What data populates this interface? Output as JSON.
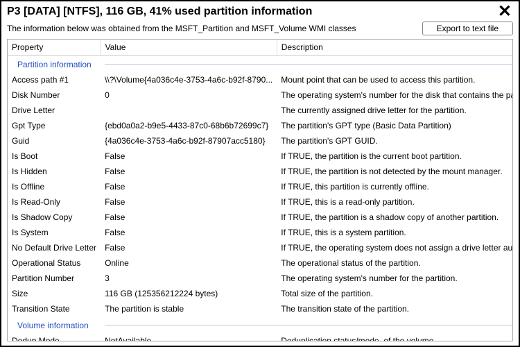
{
  "header": {
    "title": "P3 [DATA] [NTFS], 116 GB, 41% used partition information"
  },
  "subhead": {
    "text": "The information below was obtained from the MSFT_Partition and MSFT_Volume WMI classes",
    "export_label": "Export to text file"
  },
  "columns": {
    "prop": "Property",
    "val": "Value",
    "desc": "Description"
  },
  "sections": [
    {
      "name": "Partition information",
      "rows": [
        {
          "prop": "Access path #1",
          "val": "\\\\?\\Volume{4a036c4e-3753-4a6c-b92f-8790...",
          "desc": "Mount point that can be used to access this partition."
        },
        {
          "prop": "Disk Number",
          "val": "0",
          "desc": "The operating system's number for the disk that contains the partition."
        },
        {
          "prop": "Drive Letter",
          "val": "",
          "desc": "The currently assigned drive letter for the partition."
        },
        {
          "prop": "Gpt Type",
          "val": "{ebd0a0a2-b9e5-4433-87c0-68b6b72699c7}",
          "desc": "The partition's GPT type (Basic Data Partition)"
        },
        {
          "prop": "Guid",
          "val": "{4a036c4e-3753-4a6c-b92f-87907acc5180}",
          "desc": "The partition's GPT GUID."
        },
        {
          "prop": "Is Boot",
          "val": "False",
          "desc": "If TRUE, the partition is the current boot partition."
        },
        {
          "prop": "Is Hidden",
          "val": "False",
          "desc": "If TRUE, the partition is not detected by the mount manager."
        },
        {
          "prop": "Is Offline",
          "val": "False",
          "desc": "If TRUE, this partition is currently offline."
        },
        {
          "prop": "Is Read-Only",
          "val": "False",
          "desc": "If TRUE, this is a read-only partition."
        },
        {
          "prop": "Is Shadow Copy",
          "val": "False",
          "desc": "If TRUE, the partition is a shadow copy of another partition."
        },
        {
          "prop": "Is System",
          "val": "False",
          "desc": "If TRUE, this is a system partition."
        },
        {
          "prop": "No Default Drive Letter",
          "val": "False",
          "desc": "If TRUE, the operating system does not assign a drive letter automatically."
        },
        {
          "prop": "Operational Status",
          "val": "Online",
          "desc": "The operational status of the partition."
        },
        {
          "prop": "Partition Number",
          "val": "3",
          "desc": "The operating system's number for the partition."
        },
        {
          "prop": "Size",
          "val": "116 GB (125356212224 bytes)",
          "desc": "Total size of the partition."
        },
        {
          "prop": "Transition State",
          "val": "The partition is stable",
          "desc": "The transition state of the partition."
        }
      ]
    },
    {
      "name": "Volume information",
      "rows": [
        {
          "prop": "Dedup Mode",
          "val": "NotAvailable",
          "desc": "Deduplication status/mode, of the volume"
        }
      ]
    }
  ]
}
